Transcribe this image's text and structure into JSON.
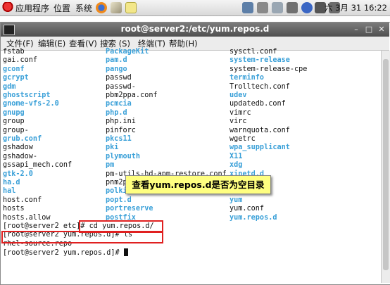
{
  "panel": {
    "menus": [
      "应用程序",
      "位置",
      "系统"
    ],
    "clock": "六 3月 31 16:22"
  },
  "window": {
    "title": "root@server2:/etc/yum.repos.d",
    "menus": [
      "文件(F)",
      "编辑(E)",
      "查看(V)",
      "搜索 (S)",
      "终端(T)",
      "帮助(H)"
    ]
  },
  "terminal": {
    "columns": [
      [
        {
          "t": "fstab",
          "d": false
        },
        {
          "t": "gai.conf",
          "d": false
        },
        {
          "t": "gconf",
          "d": true
        },
        {
          "t": "gcrypt",
          "d": true
        },
        {
          "t": "gdm",
          "d": true
        },
        {
          "t": "ghostscript",
          "d": true
        },
        {
          "t": "gnome-vfs-2.0",
          "d": true
        },
        {
          "t": "gnupg",
          "d": true
        },
        {
          "t": "group",
          "d": false
        },
        {
          "t": "group-",
          "d": false
        },
        {
          "t": "grub.conf",
          "d": true
        },
        {
          "t": "gshadow",
          "d": false
        },
        {
          "t": "gshadow-",
          "d": false
        },
        {
          "t": "gssapi_mech.conf",
          "d": false
        },
        {
          "t": "gtk-2.0",
          "d": true
        },
        {
          "t": "ha.d",
          "d": true
        },
        {
          "t": "hal",
          "d": true
        },
        {
          "t": "host.conf",
          "d": false
        },
        {
          "t": "hosts",
          "d": false
        },
        {
          "t": "hosts.allow",
          "d": false
        }
      ],
      [
        {
          "t": "PackageKit",
          "d": true
        },
        {
          "t": "pam.d",
          "d": true
        },
        {
          "t": "pango",
          "d": true
        },
        {
          "t": "passwd",
          "d": false
        },
        {
          "t": "passwd-",
          "d": false
        },
        {
          "t": "pbm2ppa.conf",
          "d": false
        },
        {
          "t": "pcmcia",
          "d": true
        },
        {
          "t": "php.d",
          "d": true
        },
        {
          "t": "php.ini",
          "d": false
        },
        {
          "t": "pinforc",
          "d": false
        },
        {
          "t": "pkcs11",
          "d": true
        },
        {
          "t": "pki",
          "d": true
        },
        {
          "t": "plymouth",
          "d": true
        },
        {
          "t": "pm",
          "d": true
        },
        {
          "t": "pm-utils-hd-apm-restore.conf",
          "d": false
        },
        {
          "t": "pnm2ppa.conf",
          "d": false
        },
        {
          "t": "polkit-1",
          "d": true
        },
        {
          "t": "popt.d",
          "d": true
        },
        {
          "t": "portreserve",
          "d": true
        },
        {
          "t": "postfix",
          "d": true
        }
      ],
      [
        {
          "t": "sysctl.conf",
          "d": false
        },
        {
          "t": "system-release",
          "d": true
        },
        {
          "t": "system-release-cpe",
          "d": false
        },
        {
          "t": "terminfo",
          "d": true
        },
        {
          "t": "Trolltech.conf",
          "d": false
        },
        {
          "t": "udev",
          "d": true
        },
        {
          "t": "updatedb.conf",
          "d": false
        },
        {
          "t": "vimrc",
          "d": false
        },
        {
          "t": "virc",
          "d": false
        },
        {
          "t": "warnquota.conf",
          "d": false
        },
        {
          "t": "wgetrc",
          "d": false
        },
        {
          "t": "wpa_supplicant",
          "d": true
        },
        {
          "t": "X11",
          "d": true
        },
        {
          "t": "xdg",
          "d": true
        },
        {
          "t": "xinetd.d",
          "d": true
        },
        {
          "t": "xml",
          "d": true
        },
        {
          "t": "yum",
          "d": true
        },
        {
          "t": "yum",
          "d": true
        },
        {
          "t": "yum.conf",
          "d": false
        },
        {
          "t": "yum.repos.d",
          "d": true
        }
      ]
    ],
    "prompt_lines": [
      "[root@server2 etc]# cd yum.repos.d/",
      "[root@server2 yum.repos.d]# ls",
      "rhel-source.repo",
      "[root@server2 yum.repos.d]# "
    ]
  },
  "callout": {
    "text": "查看yum.repos.d是否为空目录"
  }
}
